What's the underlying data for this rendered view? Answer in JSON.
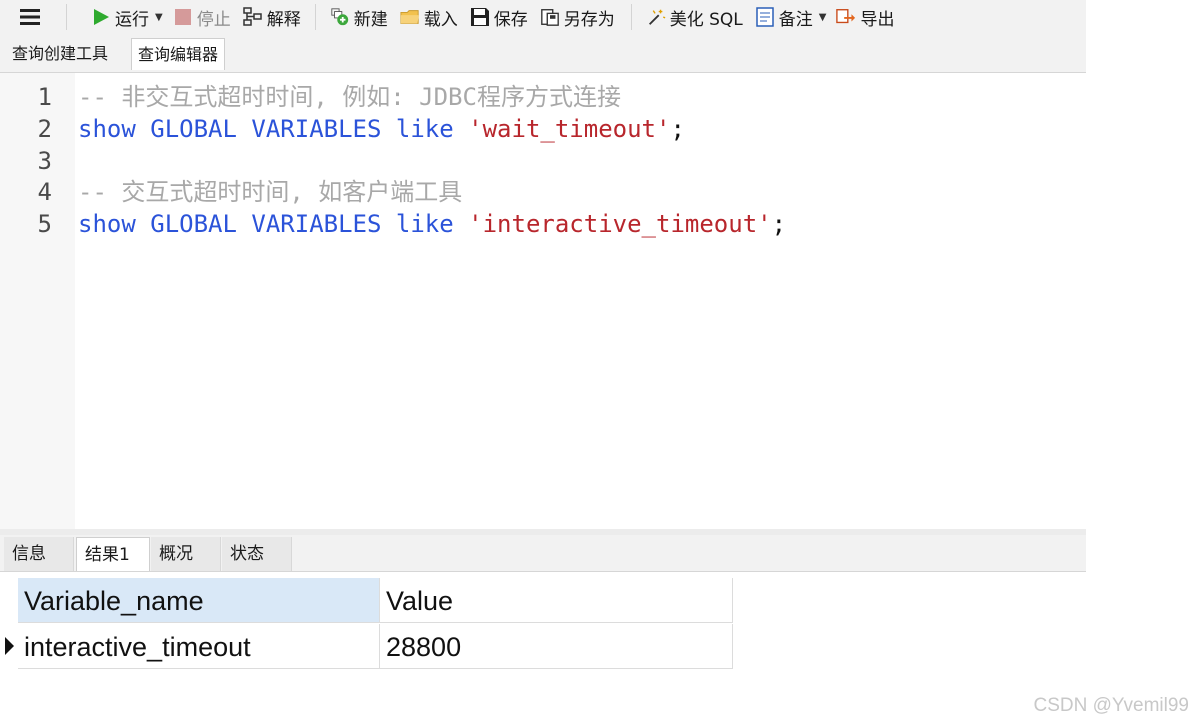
{
  "toolbar": {
    "run": "运行",
    "stop": "停止",
    "explain": "解释",
    "new": "新建",
    "load": "载入",
    "save": "保存",
    "save_as": "另存为",
    "beautify": "美化 SQL",
    "notes": "备注",
    "export": "导出"
  },
  "editor_tabs": [
    "查询创建工具",
    "查询编辑器"
  ],
  "code": {
    "line_numbers": [
      "1",
      "2",
      "3",
      "4",
      "5"
    ],
    "line1": "-- 非交互式超时时间, 例如: JDBC程序方式连接",
    "line2": {
      "kw1": "show",
      "kw2": "GLOBAL",
      "kw3": "VARIABLES",
      "kw4": "like",
      "str": "'wait_timeout'",
      "end": ";"
    },
    "line4": "-- 交互式超时时间, 如客户端工具",
    "line5": {
      "kw1": "show",
      "kw2": "GLOBAL",
      "kw3": "VARIABLES",
      "kw4": "like",
      "str": "'interactive_timeout'",
      "end": ";"
    }
  },
  "result_tabs": [
    "信息",
    "结果1",
    "概况",
    "状态"
  ],
  "result_table": {
    "columns": [
      "Variable_name",
      "Value"
    ],
    "rows": [
      [
        "interactive_timeout",
        "28800"
      ]
    ]
  },
  "watermark": "CSDN @Yvemil99",
  "colors": {
    "keyword": "#2b53d9",
    "string": "#b8262c",
    "comment": "#a8a8a8",
    "run_icon": "#2eaa2e",
    "header_selected": "#d9e8f7"
  }
}
